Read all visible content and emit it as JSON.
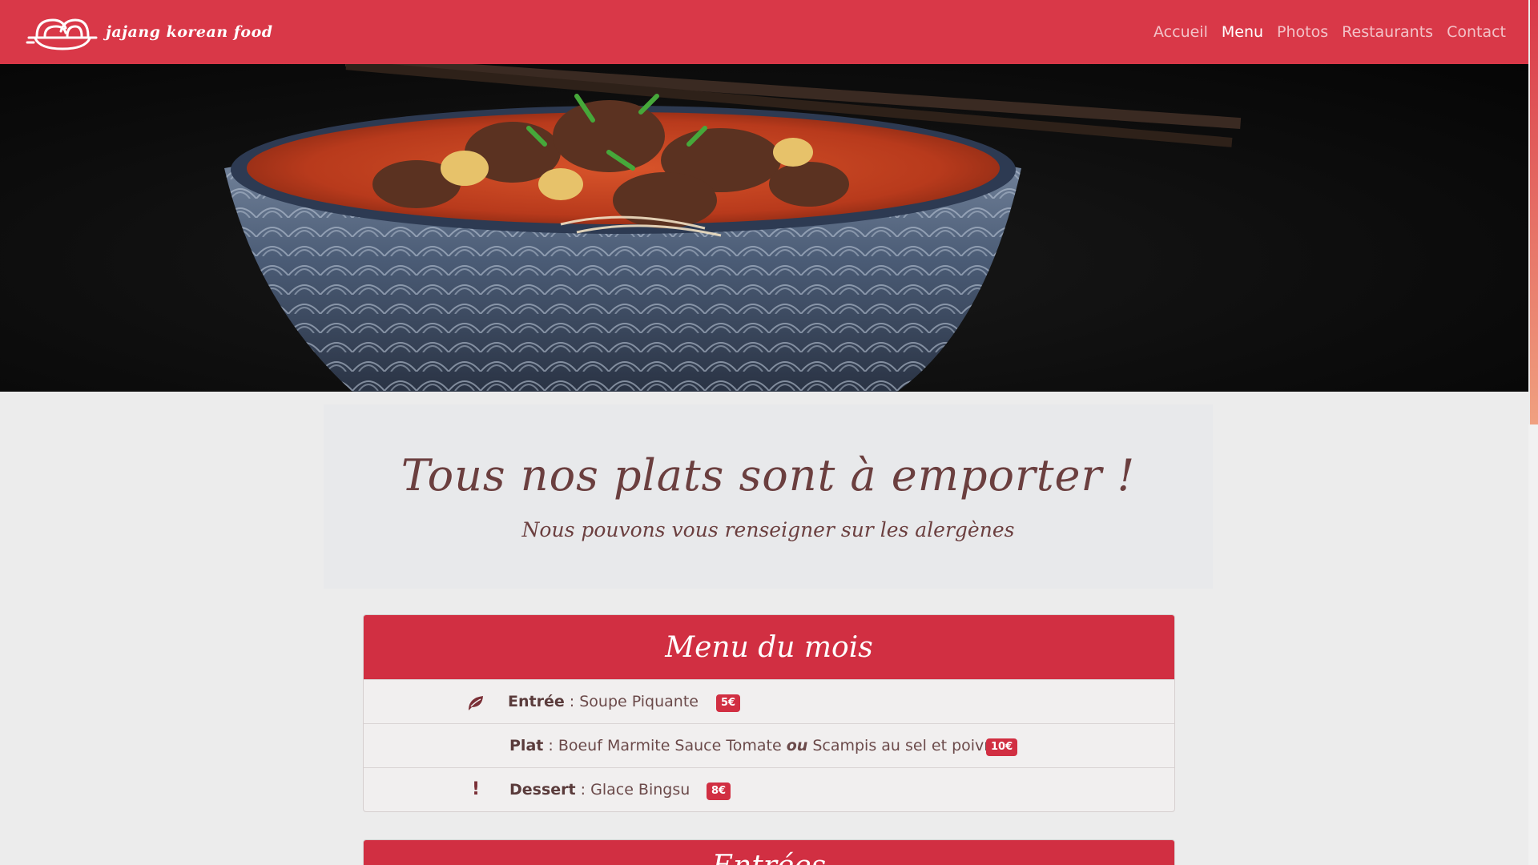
{
  "brand": {
    "name": "jajang korean food",
    "logo_icon": "noodle-bowl-icon"
  },
  "nav": {
    "items": [
      {
        "label": "Accueil",
        "active": false
      },
      {
        "label": "Menu",
        "active": true
      },
      {
        "label": "Photos",
        "active": false
      },
      {
        "label": "Restaurants",
        "active": false
      },
      {
        "label": "Contact",
        "active": false
      }
    ]
  },
  "hero": {
    "image": "korean-beef-noodle-soup-photo"
  },
  "jumbotron": {
    "title": "Tous nos plats sont à emporter !",
    "subtitle": "Nous pouvons vous renseigner sur les alergènes"
  },
  "menu_du_mois": {
    "title": "Menu du mois",
    "rows": [
      {
        "icon": "leaf-icon",
        "label": "Entrée",
        "sep": " : ",
        "item": "Soupe Piquante",
        "price": "5€"
      },
      {
        "icon": "",
        "label": "Plat",
        "sep": " : ",
        "item_a": "Boeuf Marmite Sauce Tomate",
        "or": "ou",
        "item_b": "Scampis au sel et poivre",
        "price": "10€"
      },
      {
        "icon": "exclamation-icon",
        "icon_glyph": "!",
        "label": "Dessert",
        "sep": " : ",
        "item": "Glace Bingsu",
        "price": "8€"
      }
    ]
  },
  "next_section": {
    "title": "Entrées"
  },
  "colors": {
    "primary": "#d93848",
    "card_header": "#d12f42",
    "text": "#6b3f3f",
    "background": "#ececec"
  }
}
